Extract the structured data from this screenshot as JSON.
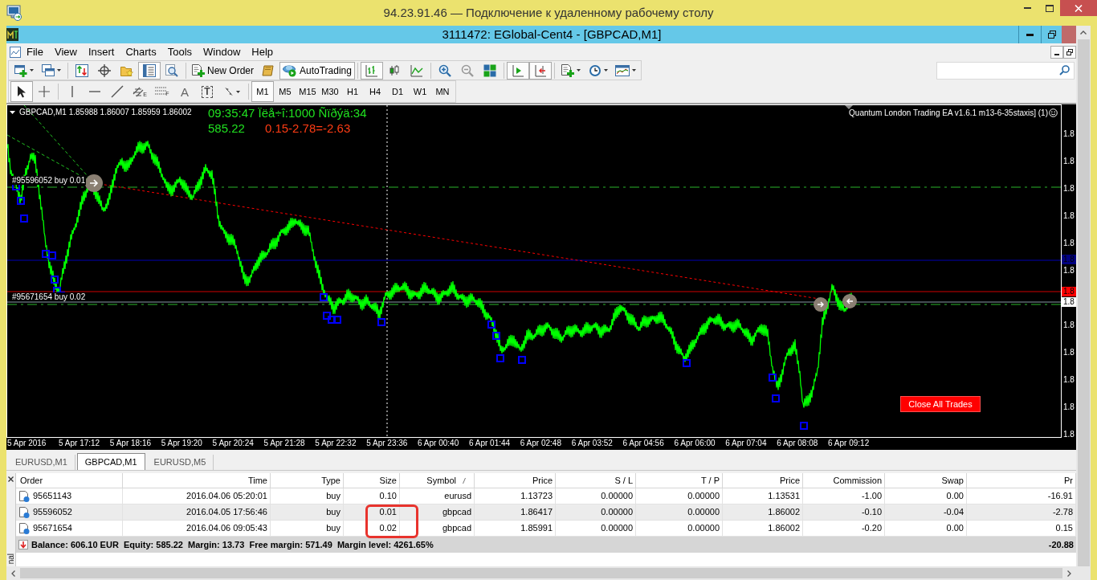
{
  "rdp_window": {
    "title": "94.23.91.46 — Подключение к удаленному рабочему столу"
  },
  "app_window": {
    "title": "3111472: EGlobal-Cent4 - [GBPCAD,M1]"
  },
  "menu": [
    "File",
    "View",
    "Insert",
    "Charts",
    "Tools",
    "Window",
    "Help"
  ],
  "toolbar": {
    "groups": [
      [
        {
          "pressed": false
        },
        {
          "pressed": false
        }
      ],
      [
        {
          "pressed": false
        },
        {
          "pressed": false
        },
        {
          "pressed": false
        },
        {
          "pressed": true
        },
        {
          "pressed": false
        }
      ],
      [
        {
          "label": "New Order",
          "pressed": false
        },
        {
          "pressed": false
        },
        {
          "label": "AutoTrading",
          "pressed": true
        }
      ],
      [
        {
          "pressed": true
        },
        {
          "pressed": false
        },
        {
          "pressed": false
        }
      ],
      [
        {
          "pressed": false
        },
        {
          "pressed": false
        },
        {
          "pressed": false
        }
      ],
      [
        {
          "pressed": true
        },
        {
          "pressed": true
        }
      ],
      [
        {
          "pressed": false
        },
        {
          "pressed": false
        },
        {
          "pressed": false
        }
      ]
    ]
  },
  "drawing_toolbar": {
    "groups": [
      [
        {
          "pressed": true
        },
        {
          "pressed": false
        }
      ],
      [
        {
          "pressed": false
        },
        {
          "pressed": false
        },
        {
          "pressed": false
        },
        {
          "label": "E",
          "pressed": false
        },
        {
          "label": "F",
          "pressed": false
        },
        {
          "label": "A",
          "pressed": false
        },
        {
          "label": "T",
          "pressed": false
        },
        {
          "pressed": false
        }
      ]
    ]
  },
  "timeframes": [
    {
      "label": "M1",
      "selected": true
    },
    {
      "label": "M5",
      "selected": false
    },
    {
      "label": "M15",
      "selected": false
    },
    {
      "label": "M30",
      "selected": false
    },
    {
      "label": "H1",
      "selected": false
    },
    {
      "label": "H4",
      "selected": false
    },
    {
      "label": "D1",
      "selected": false
    },
    {
      "label": "W1",
      "selected": false
    },
    {
      "label": "MN",
      "selected": false
    }
  ],
  "chart": {
    "symbol_info": "GBPCAD,M1 1.85988 1.86007 1.85959 1.86002",
    "info_lines": [
      [
        {
          "text": "09:35:47 Ïëå÷î:1000 Ñïðýä:34",
          "color": "#20e020"
        }
      ],
      [
        {
          "text": "585.22",
          "color": "#20e020"
        },
        {
          "text": "0.15-2.78=-2.63",
          "color": "#ff3c14"
        }
      ]
    ],
    "expert": "Quantum London Trading EA v1.6.1 m13-6-35staxis] (1)",
    "order_labels": [
      "#95596052 buy 0.01",
      "#95671654 buy 0.02"
    ],
    "close_button": "Close All Trades",
    "price_labels": [
      "1.8",
      "1.8",
      "1.8",
      "1.8",
      "1.8",
      "1.8",
      "1.8",
      "1.8",
      "1.8",
      "1.8",
      "1.8"
    ],
    "price_markers": [
      {
        "text": "1.8",
        "color": "#000080"
      },
      {
        "text": "1.8",
        "color": "#ff0000"
      },
      {
        "text": "1.8",
        "color": "#ffffff"
      }
    ],
    "time_labels": [
      "5 Apr 2016",
      "5 Apr 17:12",
      "5 Apr 18:16",
      "5 Apr 19:20",
      "5 Apr 20:24",
      "5 Apr 21:28",
      "5 Apr 22:32",
      "5 Apr 23:36",
      "6 Apr 00:40",
      "6 Apr 01:44",
      "6 Apr 02:48",
      "6 Apr 03:52",
      "6 Apr 04:56",
      "6 Apr 06:00",
      "6 Apr 07:04",
      "6 Apr 08:08",
      "6 Apr 09:12"
    ]
  },
  "chart_tabs": [
    {
      "label": "EURUSD,M1",
      "selected": false
    },
    {
      "label": "GBPCAD,M1",
      "selected": true
    },
    {
      "label": "EURUSD,M5",
      "selected": false
    }
  ],
  "terminal": {
    "columns": [
      "Order",
      "Time",
      "Type",
      "Size",
      "Symbol",
      "Price",
      "S / L",
      "T / P",
      "Price",
      "Commission",
      "Swap",
      "Pr"
    ],
    "rows": [
      {
        "cells": [
          "95651143",
          "2016.04.06 05:20:01",
          "buy",
          "0.10",
          "eurusd",
          "1.13723",
          "0.00000",
          "0.00000",
          "1.13531",
          "-1.00",
          "0.00",
          "-16.91"
        ]
      },
      {
        "cells": [
          "95596052",
          "2016.04.05 17:56:46",
          "buy",
          "0.01",
          "gbpcad",
          "1.86417",
          "0.00000",
          "0.00000",
          "1.86002",
          "-0.10",
          "-0.04",
          "-2.78"
        ]
      },
      {
        "cells": [
          "95671654",
          "2016.04.06 09:05:43",
          "buy",
          "0.02",
          "gbpcad",
          "1.85991",
          "0.00000",
          "0.00000",
          "1.86002",
          "-0.20",
          "0.00",
          "0.15"
        ]
      }
    ],
    "summary": {
      "text": "Balance: 606.10 EUR  Equity: 585.22  Margin: 13.73  Free margin: 571.49  Margin level: 4261.65%",
      "profit": "-20.88"
    },
    "side_label": "nal"
  }
}
